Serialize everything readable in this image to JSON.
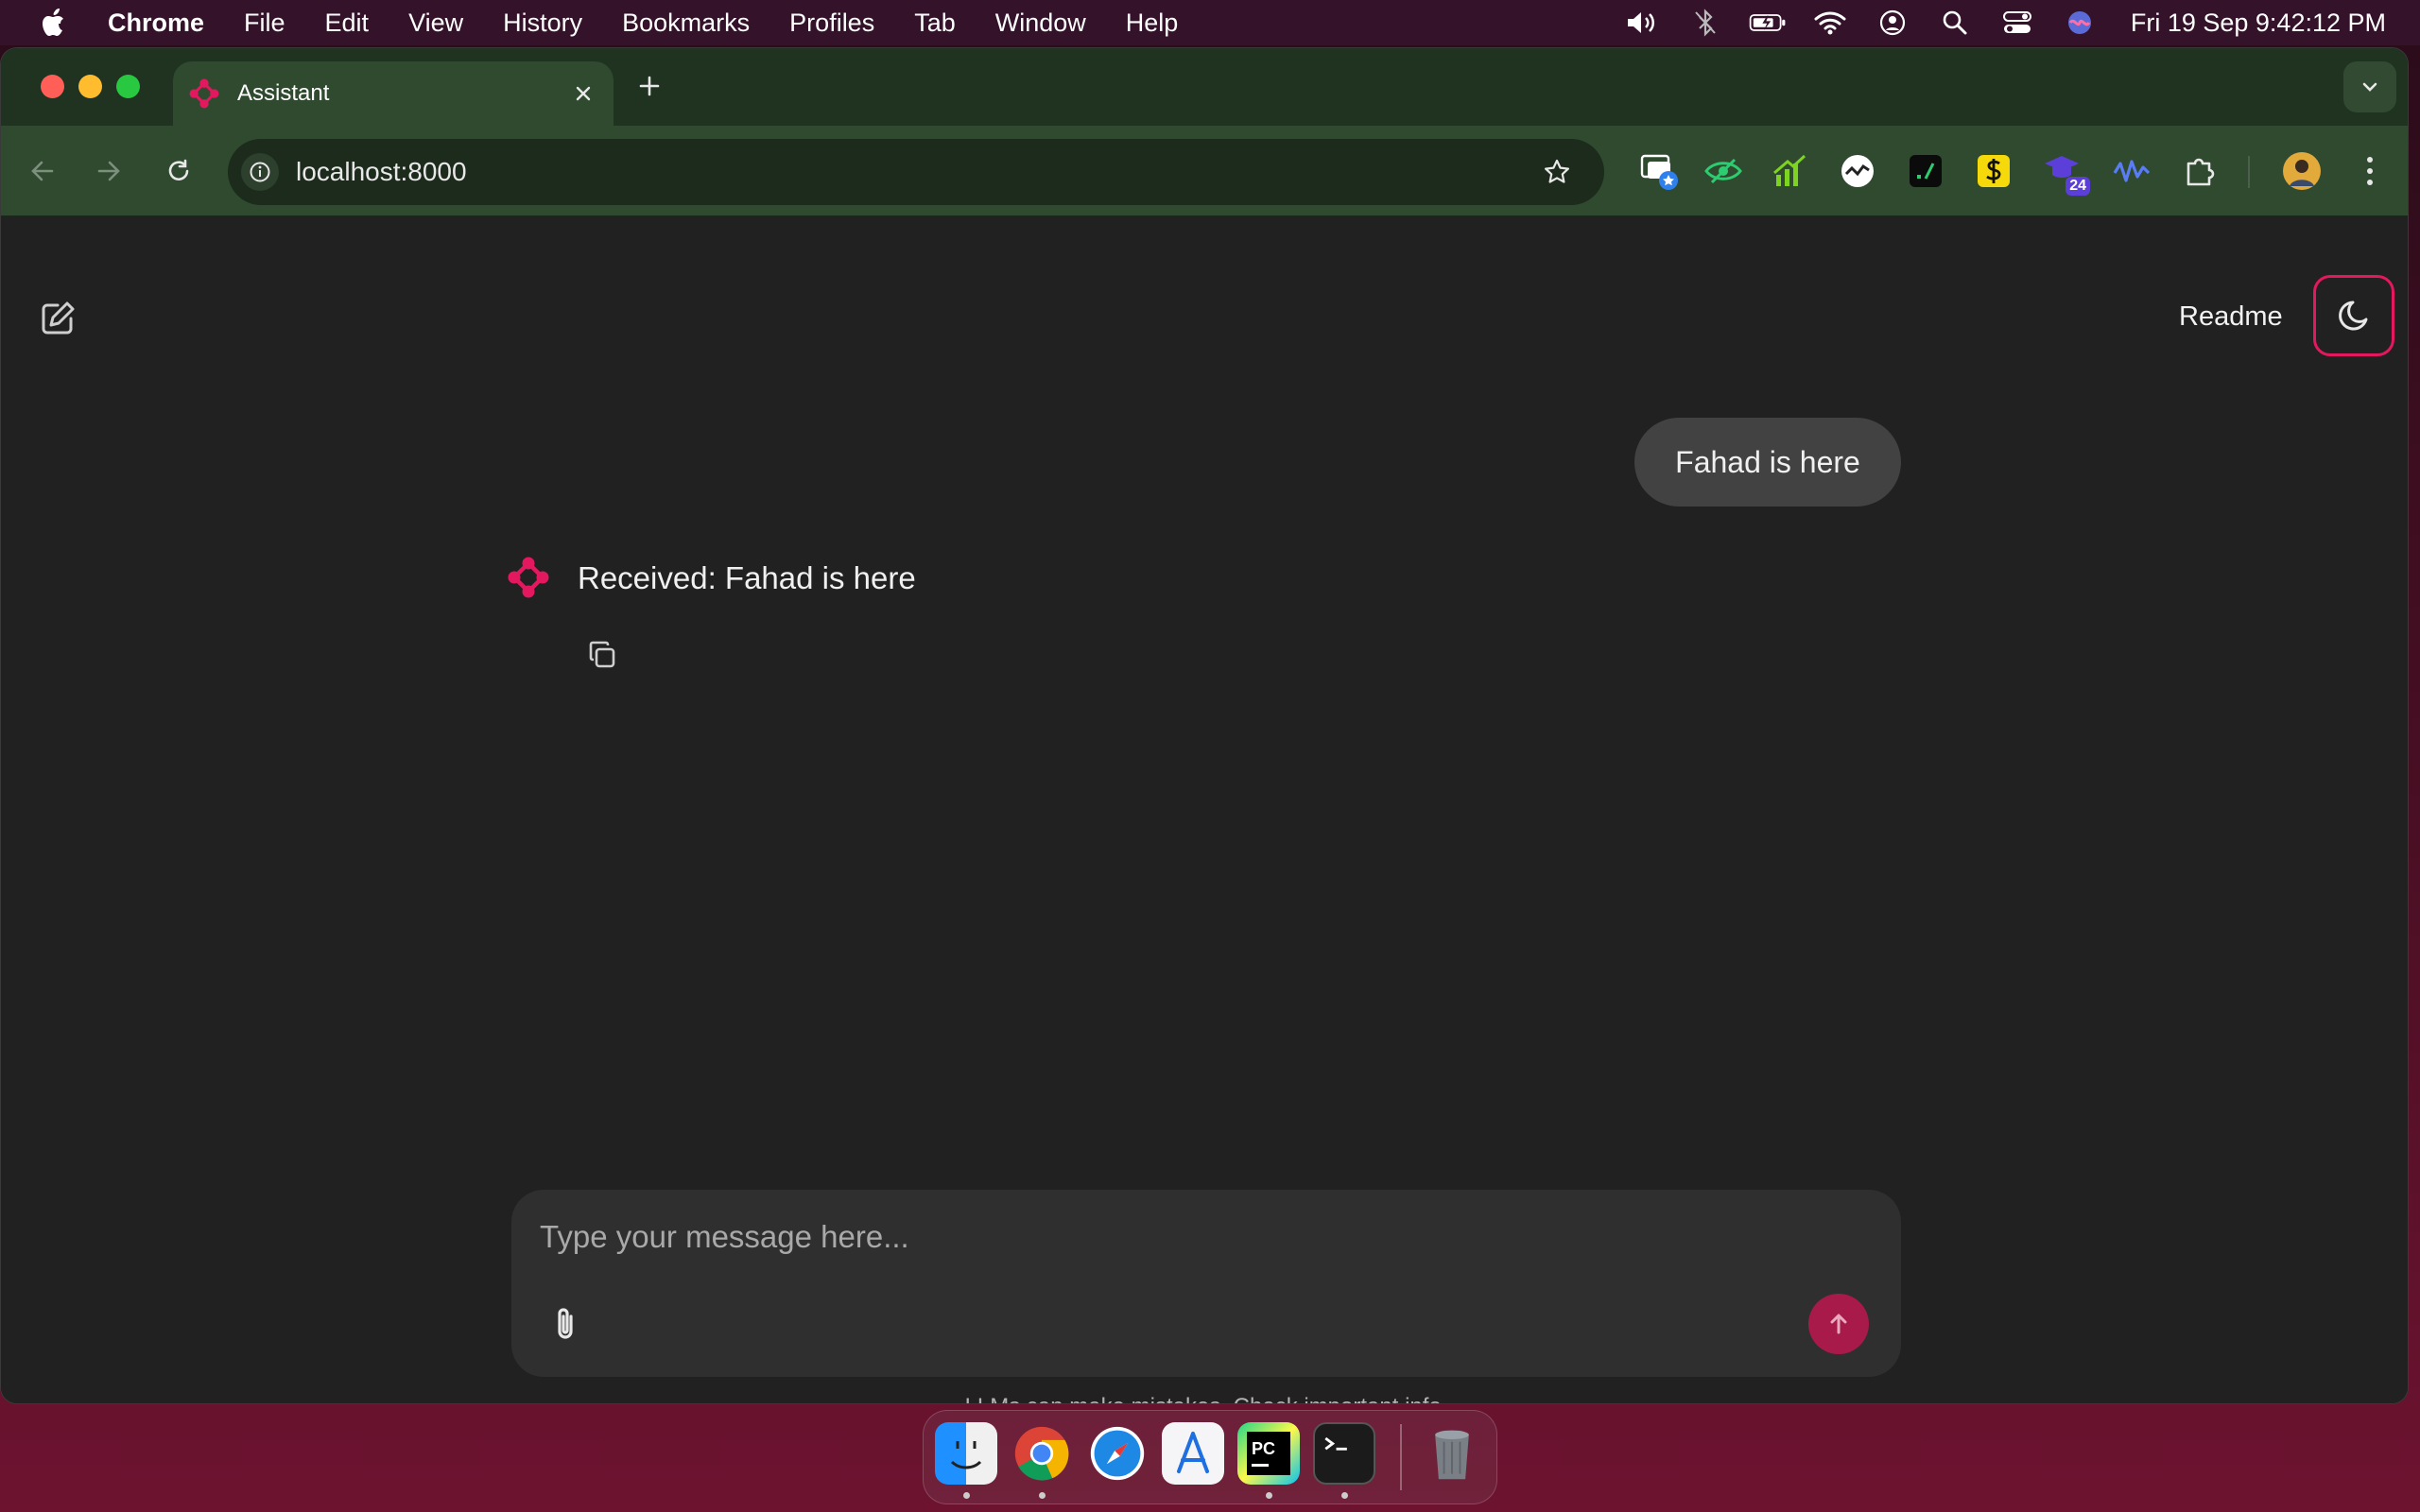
{
  "menubar": {
    "app_name": "Chrome",
    "menus": [
      "File",
      "Edit",
      "View",
      "History",
      "Bookmarks",
      "Profiles",
      "Tab",
      "Window",
      "Help"
    ],
    "clock": "Fri 19 Sep  9:42:12 PM"
  },
  "browser": {
    "tab_title": "Assistant",
    "url": "localhost:8000",
    "extension_badge": "24"
  },
  "page": {
    "readme_label": "Readme",
    "user_message": "Fahad is here",
    "assistant_message": "Received: Fahad is here",
    "input_placeholder": "Type your message here...",
    "disclaimer": "LLMs can make mistakes. Check important info."
  },
  "colors": {
    "accent": "#e3185e",
    "send_button": "#a81a49",
    "page_background": "#212121",
    "composer_background": "#2f2f2f",
    "user_bubble": "#424242",
    "browser_toolbar": "#2f4a2f"
  },
  "icons": {
    "menubar": [
      "apple-icon",
      "volume-icon",
      "bluetooth-icon",
      "battery-icon",
      "wifi-icon",
      "user-account-icon",
      "spotlight-search-icon",
      "control-center-icon",
      "siri-icon"
    ],
    "toolbar": [
      "back-icon",
      "forward-icon",
      "reload-icon",
      "site-info-icon",
      "bookmark-star-icon",
      "extensions-puzzle-icon",
      "kebab-menu-icon"
    ],
    "page": [
      "new-chat-icon",
      "moon-icon",
      "assistant-logo-icon",
      "copy-icon",
      "paperclip-icon",
      "arrow-up-icon"
    ],
    "dock": [
      "finder-icon",
      "chrome-icon",
      "safari-icon",
      "app-store-icon",
      "pycharm-icon",
      "terminal-icon",
      "trash-icon"
    ]
  }
}
